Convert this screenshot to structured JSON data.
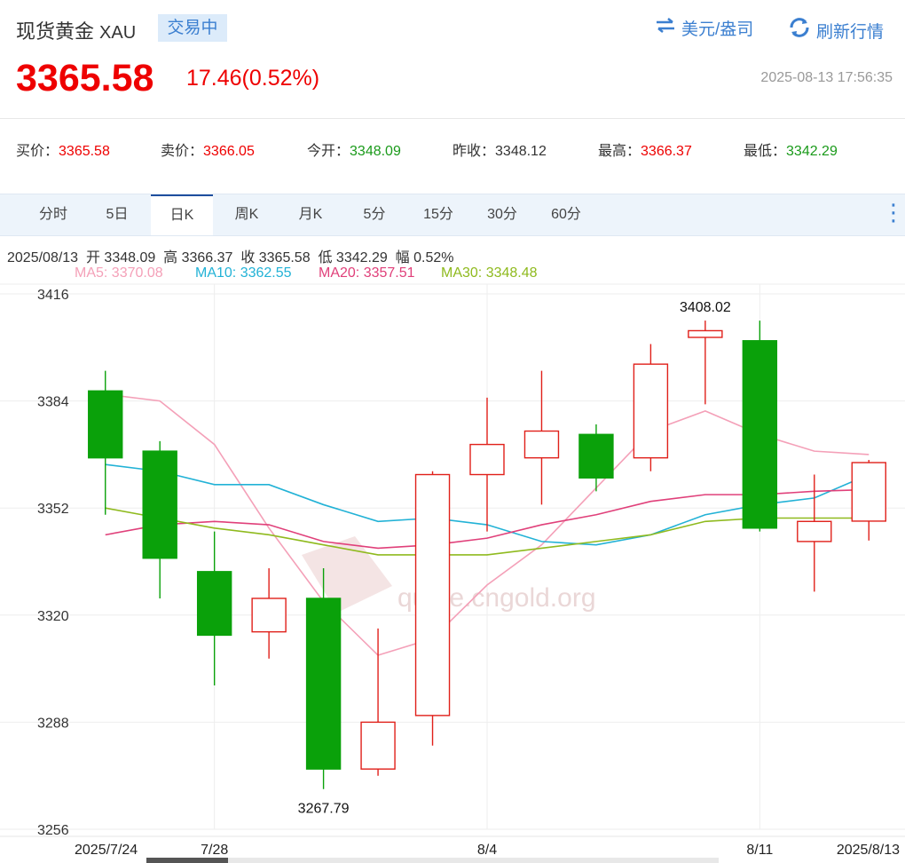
{
  "header": {
    "name": "现货黄金",
    "code": "XAU",
    "status": "交易中",
    "currency_toggle": "美元/盎司",
    "refresh": "刷新行情",
    "price": "3365.58",
    "change": "17.46(0.52%)",
    "timestamp": "2025-08-13 17:56:35"
  },
  "quotes": [
    {
      "label": "买价：",
      "value": "3365.58",
      "dir": "up"
    },
    {
      "label": "卖价：",
      "value": "3366.05",
      "dir": "up"
    },
    {
      "label": "今开：",
      "value": "3348.09",
      "dir": "dn"
    },
    {
      "label": "昨收：",
      "value": "3348.12",
      "dir": "flat"
    },
    {
      "label": "最高：",
      "value": "3366.37",
      "dir": "up"
    },
    {
      "label": "最低：",
      "value": "3342.29",
      "dir": "dn"
    }
  ],
  "tabs": [
    "分时",
    "5日",
    "日K",
    "周K",
    "月K",
    "5分",
    "15分",
    "30分",
    "60分"
  ],
  "active_tab": "日K",
  "info_line": "2025/08/13  开 3348.09  高 3366.37  收 3365.58  低 3342.29  幅 0.52%",
  "ma_legend": [
    {
      "label": "MA5: 3370.08",
      "color": "#f4a0b8"
    },
    {
      "label": "MA10: 3362.55",
      "color": "#22b2d6"
    },
    {
      "label": "MA20: 3357.51",
      "color": "#e0407a"
    },
    {
      "label": "MA30: 3348.48",
      "color": "#8fba1e"
    }
  ],
  "watermark": "quote.cngold.org",
  "colors": {
    "up": "#e0201a",
    "down": "#0aa10a"
  },
  "chart_data": {
    "type": "candlestick",
    "ylim": [
      3256,
      3416
    ],
    "yticks": [
      3416,
      3384,
      3352,
      3320,
      3288,
      3256
    ],
    "xtick_labels": [
      {
        "index": 0,
        "label": "2025/7/24"
      },
      {
        "index": 2,
        "label": "7/28"
      },
      {
        "index": 7,
        "label": "8/4"
      },
      {
        "index": 12,
        "label": "8/11"
      },
      {
        "index": 14,
        "label": "2025/8/13"
      }
    ],
    "annotations": [
      {
        "index": 11,
        "value": 3408.02,
        "label": "3408.02",
        "position": "above"
      },
      {
        "index": 4,
        "value": 3267.79,
        "label": "3267.79",
        "position": "below"
      }
    ],
    "candles": [
      {
        "open": 3387,
        "close": 3367,
        "high": 3393,
        "low": 3350
      },
      {
        "open": 3369,
        "close": 3337,
        "high": 3372,
        "low": 3325
      },
      {
        "open": 3333,
        "close": 3314,
        "high": 3345,
        "low": 3299
      },
      {
        "open": 3315,
        "close": 3325,
        "high": 3334,
        "low": 3307
      },
      {
        "open": 3325,
        "close": 3274,
        "high": 3334,
        "low": 3268
      },
      {
        "open": 3274,
        "close": 3288,
        "high": 3316,
        "low": 3272
      },
      {
        "open": 3290,
        "close": 3362,
        "high": 3363,
        "low": 3281
      },
      {
        "open": 3362,
        "close": 3371,
        "high": 3385,
        "low": 3345
      },
      {
        "open": 3367,
        "close": 3375,
        "high": 3393,
        "low": 3353
      },
      {
        "open": 3374,
        "close": 3361,
        "high": 3377,
        "low": 3357
      },
      {
        "open": 3367,
        "close": 3395,
        "high": 3401,
        "low": 3363
      },
      {
        "open": 3403,
        "close": 3405,
        "high": 3408.02,
        "low": 3383
      },
      {
        "open": 3402,
        "close": 3346,
        "high": 3408,
        "low": 3345
      },
      {
        "open": 3342,
        "close": 3348,
        "high": 3362,
        "low": 3327
      },
      {
        "open": 3348.09,
        "close": 3365.58,
        "high": 3366.37,
        "low": 3342.29
      }
    ],
    "series": [
      {
        "name": "MA5",
        "values": [
          3386,
          3384,
          3371,
          3346,
          3324,
          3308,
          3313,
          3329,
          3341,
          3358,
          3375,
          3381,
          3374,
          3369,
          3368
        ]
      },
      {
        "name": "MA10",
        "values": [
          3365,
          3363,
          3359,
          3359,
          3353,
          3348,
          3349,
          3347,
          3342,
          3341,
          3344,
          3350,
          3353,
          3355,
          3362
        ]
      },
      {
        "name": "MA20",
        "values": [
          3344,
          3347,
          3348,
          3347,
          3342,
          3340,
          3341,
          3343,
          3347,
          3350,
          3354,
          3356,
          3356,
          3357,
          3357.5
        ]
      },
      {
        "name": "MA30",
        "values": [
          3352,
          3349,
          3346,
          3344,
          3341,
          3338,
          3338,
          3338,
          3340,
          3342,
          3344,
          3348,
          3349,
          3349,
          3349
        ]
      }
    ]
  }
}
